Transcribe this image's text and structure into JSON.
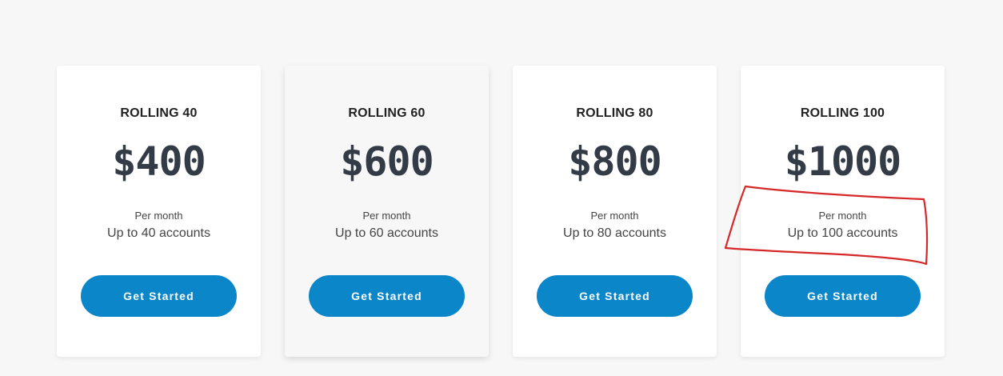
{
  "plans": [
    {
      "name": "ROLLING 40",
      "price": "$400",
      "period": "Per month",
      "accounts": "Up to 40 accounts",
      "cta": "Get Started"
    },
    {
      "name": "ROLLING 60",
      "price": "$600",
      "period": "Per month",
      "accounts": "Up to 60 accounts",
      "cta": "Get Started"
    },
    {
      "name": "ROLLING 80",
      "price": "$800",
      "period": "Per month",
      "accounts": "Up to 80 accounts",
      "cta": "Get Started"
    },
    {
      "name": "ROLLING 100",
      "price": "$1000",
      "period": "Per month",
      "accounts": "Up to 100 accounts",
      "cta": "Get Started"
    }
  ],
  "colors": {
    "page_background": "#f7f7f7",
    "card_background": "#ffffff",
    "price_text": "#333b47",
    "button": "#0a86c9",
    "annotation": "#d62828"
  }
}
